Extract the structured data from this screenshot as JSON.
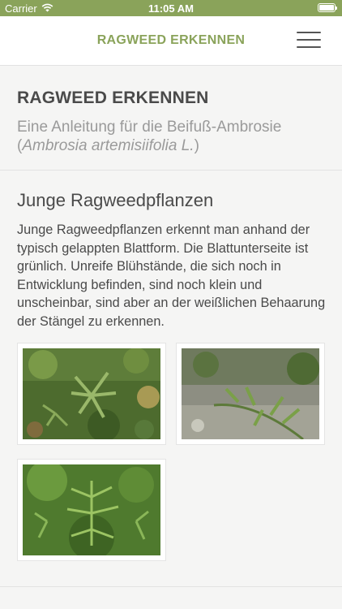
{
  "status_bar": {
    "carrier": "Carrier",
    "time": "11:05 AM"
  },
  "nav": {
    "title": "RAGWEED ERKENNEN"
  },
  "header": {
    "title": "RAGWEED ERKENNEN",
    "subtitle_main": "Eine Anleitung für die Beifuß-Ambrosie",
    "subtitle_open": "(",
    "subtitle_latin": "Ambrosia artemisiifolia L.",
    "subtitle_close": ")"
  },
  "section": {
    "title": "Junge Ragweedpflanzen",
    "text": "Junge Ragweedpflanzen erkennt man anhand der typisch gelappten Blattform. Die Blattunterseite ist grünlich. Unreife Blühstände, die sich noch in Entwicklung befinden, sind noch klein und unscheinbar, sind aber an der weißlichen Behaarung der Stängel zu erkennen."
  },
  "colors": {
    "accent": "#8aa35a",
    "background": "#f5f5f4"
  },
  "icons": {
    "menu": "hamburger-menu-icon",
    "wifi": "wifi-icon",
    "battery": "battery-icon"
  }
}
